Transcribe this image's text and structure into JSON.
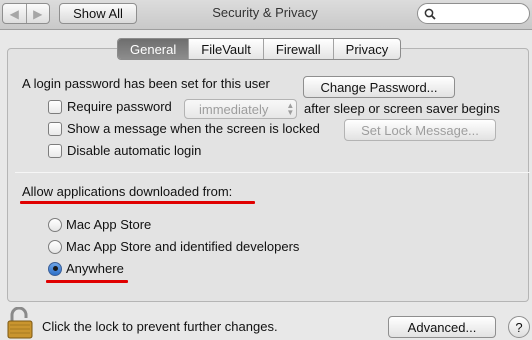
{
  "window": {
    "title": "Security & Privacy",
    "show_all": "Show All",
    "nav_back": "◀",
    "nav_forward": "▶"
  },
  "search": {
    "placeholder": ""
  },
  "tabs": [
    {
      "label": "General",
      "active": true
    },
    {
      "label": "FileVault",
      "active": false
    },
    {
      "label": "Firewall",
      "active": false
    },
    {
      "label": "Privacy",
      "active": false
    }
  ],
  "general": {
    "login_password_text": "A login password has been set for this user",
    "change_password_button": "Change Password...",
    "require_password": {
      "label": "Require password",
      "checked": false,
      "select_value": "immediately",
      "suffix": "after sleep or screen saver begins"
    },
    "show_message": {
      "label": "Show a message when the screen is locked",
      "checked": false,
      "button": "Set Lock Message..."
    },
    "disable_auto_login": {
      "label": "Disable automatic login",
      "checked": false
    }
  },
  "downloads": {
    "heading": "Allow applications downloaded from:",
    "options": [
      {
        "label": "Mac App Store",
        "selected": false
      },
      {
        "label": "Mac App Store and identified developers",
        "selected": false
      },
      {
        "label": "Anywhere",
        "selected": true
      }
    ]
  },
  "footer": {
    "lock_text": "Click the lock to prevent further changes.",
    "advanced_button": "Advanced...",
    "help_button": "?"
  },
  "colors": {
    "annotation_red": "#e00000",
    "selected_radio": "#2c6fc8"
  }
}
